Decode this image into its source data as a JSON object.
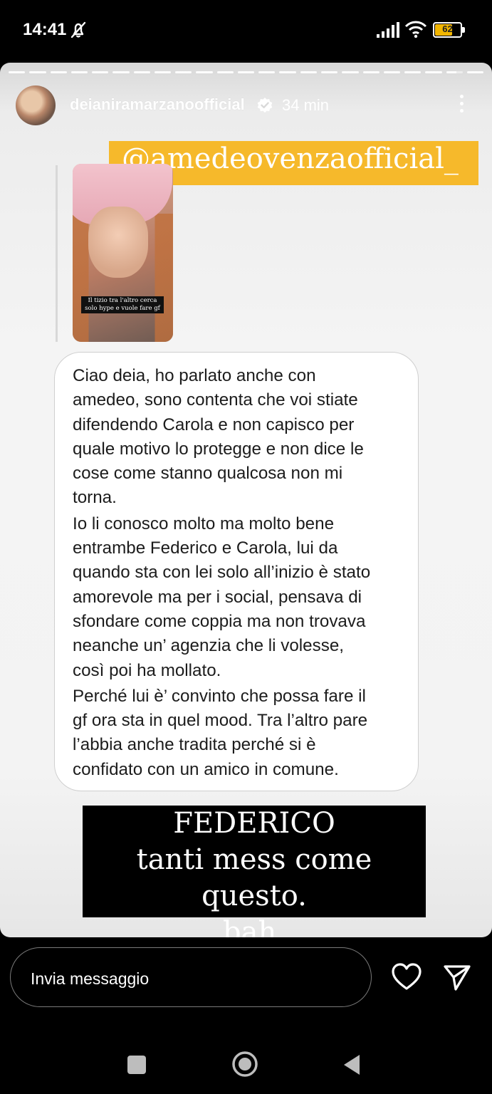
{
  "status_bar": {
    "time": "14:41",
    "battery": "62",
    "icons": [
      "mute-icon",
      "signal-icon",
      "wifi-icon",
      "battery-icon"
    ]
  },
  "story": {
    "username": "deianiramarzanoofficial",
    "time_ago": "34 min",
    "mention": "@amedeovenzaofficial_",
    "quoted_caption": "Il tizio tra l'altro cerca solo hype e vuole fare gf",
    "message_paragraphs": [
      "Ciao deia, ho parlato anche con\namedeo, sono contenta che voi stiate\ndifendendo Carola e non capisco per\nquale motivo lo protegge e non dice le\ncose come stanno qualcosa non mi\ntorna.",
      "Io li conosco molto ma molto bene\nentrambe Federico e Carola, lui da\nquando sta con lei solo all’inizio è stato\namorevole ma per i social, pensava di\nsfondare come coppia  ma non trovava\nneanche un’ agenzia che li volesse,\ncosì poi ha mollato.",
      "Perché lui è’ convinto che possa fare il\ngf ora sta in quel mood. Tra l’altro pare\nl’abbia anche tradita perché si è\nconfidato con un amico in comune."
    ],
    "caption_lines": [
      "FEDERICO",
      "tanti mess come questo.",
      "bah."
    ],
    "mention_color": "#f6b92b"
  },
  "reply_bar": {
    "placeholder": "Invia messaggio"
  }
}
